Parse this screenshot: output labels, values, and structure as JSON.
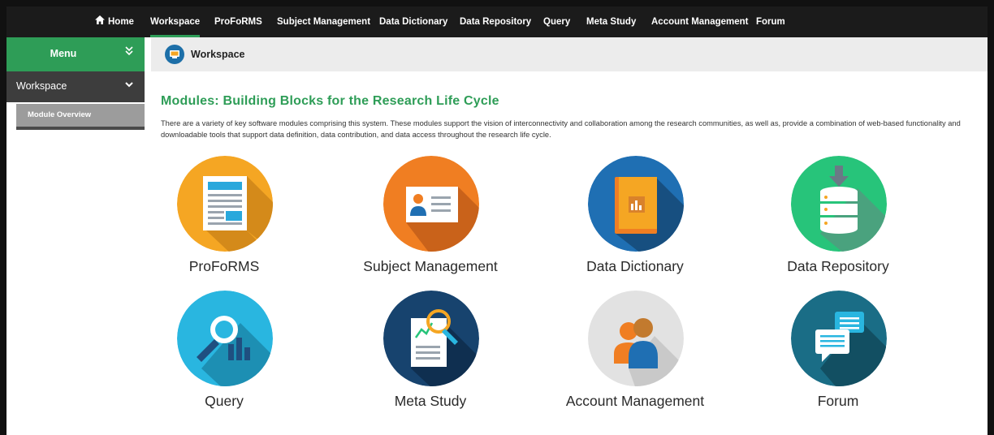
{
  "topnav": {
    "items": [
      {
        "label": "Home",
        "icon": "home-icon"
      },
      {
        "label": "Workspace",
        "active": true
      },
      {
        "label": "ProFoRMS"
      },
      {
        "label": "Subject Management"
      },
      {
        "label": "Data Dictionary"
      },
      {
        "label": "Data Repository"
      },
      {
        "label": "Query"
      },
      {
        "label": "Meta Study"
      },
      {
        "label": "Account Management"
      },
      {
        "label": "Forum"
      }
    ]
  },
  "sidebar": {
    "menu_label": "Menu",
    "menu_icon": "double-chevron-down-icon",
    "workspace_label": "Workspace",
    "workspace_icon": "chevron-down-icon",
    "sub_items": [
      {
        "label": "Module Overview"
      }
    ]
  },
  "breadcrumb": {
    "title": "Workspace",
    "icon": "workspace-icon"
  },
  "main": {
    "heading": "Modules: Building Blocks for the Research Life Cycle",
    "intro": "There are a variety of key software modules comprising this system. These modules support the vision of interconnectivity and collaboration among the research communities, as well as, provide a combination of web-based functionality and downloadable tools that support data definition, data contribution, and data access throughout the research life cycle.",
    "modules": [
      {
        "label": "ProFoRMS",
        "icon": "forms-icon",
        "color": "#f5a623"
      },
      {
        "label": "Subject Management",
        "icon": "id-card-icon",
        "color": "#f07e22"
      },
      {
        "label": "Data Dictionary",
        "icon": "book-icon",
        "color": "#1f6fb3"
      },
      {
        "label": "Data Repository",
        "icon": "database-download-icon",
        "color": "#27c47a"
      },
      {
        "label": "Query",
        "icon": "magnifier-chart-icon",
        "color": "#29b6e0"
      },
      {
        "label": "Meta Study",
        "icon": "document-magnifier-icon",
        "color": "#17436e"
      },
      {
        "label": "Account Management",
        "icon": "users-icon",
        "color": "#e2e2e2"
      },
      {
        "label": "Forum",
        "icon": "chat-bubbles-icon",
        "color": "#1a6d86"
      }
    ]
  }
}
